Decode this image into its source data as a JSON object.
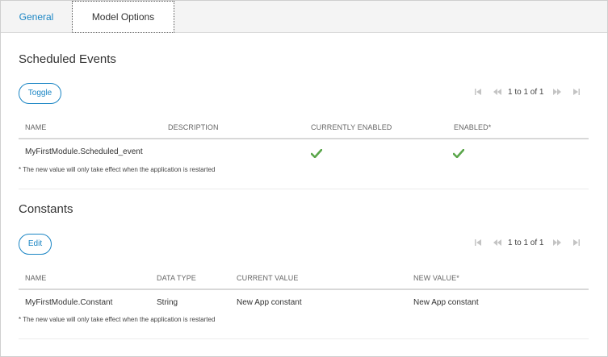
{
  "tabs": [
    {
      "label": "General"
    },
    {
      "label": "Model Options"
    }
  ],
  "scheduled_events": {
    "title": "Scheduled Events",
    "toggle_label": "Toggle",
    "pager_text": "1 to 1 of 1",
    "columns": [
      "NAME",
      "DESCRIPTION",
      "CURRENTLY ENABLED",
      "ENABLED*"
    ],
    "rows": [
      {
        "name": "MyFirstModule.Scheduled_event",
        "description": "",
        "currently_enabled": true,
        "enabled": true
      }
    ],
    "footnote": "* The new value will only take effect when the application is restarted"
  },
  "constants": {
    "title": "Constants",
    "edit_label": "Edit",
    "pager_text": "1 to 1 of 1",
    "columns": [
      "NAME",
      "DATA TYPE",
      "CURRENT VALUE",
      "NEW VALUE*"
    ],
    "rows": [
      {
        "name": "MyFirstModule.Constant",
        "data_type": "String",
        "current_value": "New App constant",
        "new_value": "New App constant"
      }
    ],
    "footnote": "* The new value will only take effect when the application is restarted"
  },
  "colors": {
    "accent": "#1a85c4",
    "check": "#5aa64a",
    "pager_icon": "#c4c4c4"
  },
  "icons": {
    "pager": [
      "first-page-icon",
      "previous-page-icon",
      "next-page-icon",
      "last-page-icon"
    ],
    "enabled": "checkmark-icon"
  }
}
